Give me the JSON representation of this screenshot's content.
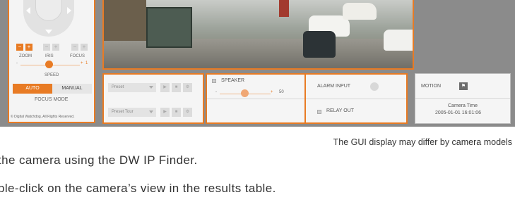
{
  "colors": {
    "accent": "#e87b24",
    "frame": "#8b8b8b",
    "panel": "#f5f5f5"
  },
  "ptz": {
    "controls": {
      "minus": "−",
      "plus": "+"
    },
    "labels": {
      "zoom": "ZOOM",
      "iris": "IRIS",
      "focus": "FOCUS"
    },
    "slider": {
      "min_label": "-",
      "max_label": "+",
      "value": "1",
      "label": "SPEED"
    },
    "modes": {
      "auto": "AUTO",
      "manual": "MANUAL"
    },
    "focus_mode_label": "FOCUS MODE",
    "copyright": "© Digital Watchdog. All Rights Reserved."
  },
  "preset": {
    "preset_select": "Preset",
    "tour_select": "Preset Tour",
    "icons": [
      "play-icon",
      "stop-icon",
      "settings-icon"
    ]
  },
  "speaker": {
    "label": "SPEAKER",
    "min": "-",
    "max": "+",
    "value": "50"
  },
  "alarm": {
    "alarm_input_label": "ALARM INPUT",
    "relay_out_label": "RELAY OUT"
  },
  "motion": {
    "label": "MOTION"
  },
  "camera_time": {
    "label": "Camera Time",
    "value": "2005-01-01 16:01:06"
  },
  "manual": {
    "caption": "The GUI display may differ by camera models",
    "line1": "the camera using the DW IP Finder.",
    "line2": "ble-click on the camera’s view in the results table."
  }
}
